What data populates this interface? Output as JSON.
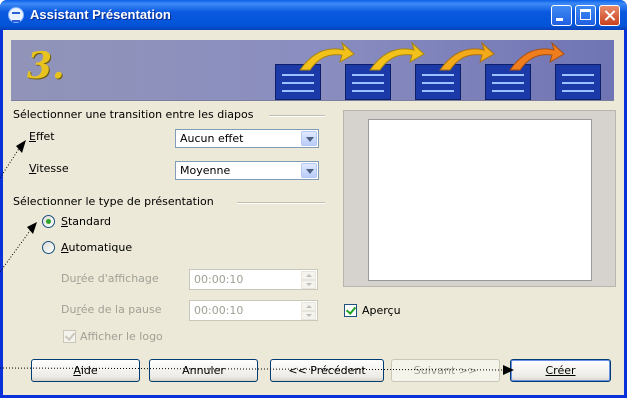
{
  "window": {
    "title": "Assistant Présentation"
  },
  "banner": {
    "step": "3."
  },
  "transition": {
    "group_label": "Sélectionner une transition entre les diapos",
    "effect_label": "Effet",
    "effect_value": "Aucun effet",
    "speed_label": "Vitesse",
    "speed_value": "Moyenne"
  },
  "presentation_type": {
    "group_label": "Sélectionner le type de présentation",
    "standard_label": "Standard",
    "auto_label": "Automatique",
    "selected": "Standard",
    "display_duration_label": "Durée d'affichage",
    "display_duration_value": "00:00:10",
    "pause_duration_label": "Durée de la pause",
    "pause_duration_value": "00:00:10",
    "show_logo_label": "Afficher le logo"
  },
  "preview": {
    "checkbox_label": "Aperçu",
    "checked": true
  },
  "buttons": {
    "help": "Aide",
    "cancel": "Annuler",
    "previous": "<< Précédent",
    "next": "Suivant >>",
    "create": "Créer"
  },
  "colors": {
    "title_bar": "#0A59E0",
    "banner": "#8A8EC0",
    "step_number": "#E8C320",
    "dialog_bg": "#ECE9D8"
  }
}
